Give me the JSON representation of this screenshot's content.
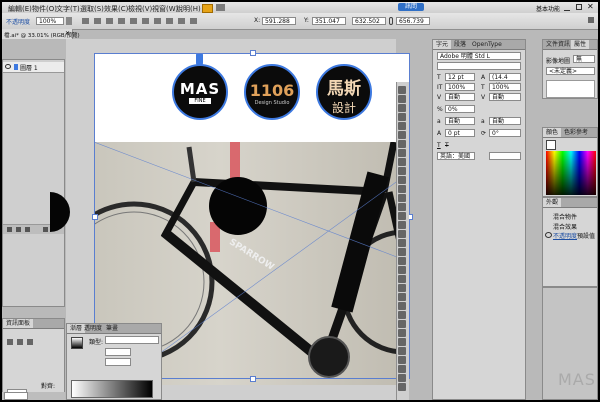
{
  "menubar": {
    "items": [
      "編輯(E)",
      "物件(O)",
      "文字(T)",
      "選取(S)",
      "效果(C)",
      "檢視(V)",
      "視窗(W)",
      "說明(H)"
    ],
    "workspace_label": "基本功能",
    "search_badge": "訊問"
  },
  "controlbar": {
    "selection_label": "不透明度",
    "opacity_value": "100%",
    "x_label": "X:",
    "x_value": "591.288",
    "y_label": "Y:",
    "y_value": "351.047",
    "w_label": "W:",
    "w_value": "632.502",
    "h_label": "H:",
    "h_value": "656.739"
  },
  "document": {
    "tab_title": "檔.ai* @ 33.01% (RGB/預覽)",
    "logos": [
      {
        "text": "MAS",
        "sub": "FINE"
      },
      {
        "text": "1106",
        "sub": "Design Studio"
      },
      {
        "text": "馬斯",
        "sub": "設計"
      }
    ],
    "bike_text": "SPARROW"
  },
  "layers_panel": {
    "layer_name": "圖層 1"
  },
  "character_panel": {
    "tabs": [
      "字元",
      "段落",
      "OpenType"
    ],
    "font_family": "Adobe 明體 Std L",
    "font_style": "",
    "size": "12 pt",
    "leading": "(14.4 pt)",
    "vscale": "100%",
    "hscale": "100%",
    "kerning": "自動",
    "tracking": "自動",
    "tsume": "0%",
    "baseline": "0 pt",
    "rotate": "0°",
    "language": "英語：美國",
    "auto1": "自動",
    "auto2": "自動"
  },
  "right_panel": {
    "tabs": [
      "文件資訊",
      "屬性"
    ],
    "image_map_label": "影像地圖",
    "image_map_value": "無",
    "url_value": "<未定義>",
    "color_tabs": [
      "顏色",
      "色彩參考"
    ],
    "appearance_title": "外觀",
    "appearance_row1": "混合物件",
    "appearance_row2": "混合效果",
    "appearance_row3": "不透明度",
    "appearance_row3_value": "預設值"
  },
  "gradient_panel": {
    "tabs": [
      "漸層",
      "透明度",
      "筆畫"
    ],
    "type_label": "類型:",
    "opacity_label": "不透明度:",
    "location_label": "對齊:"
  },
  "bottom_left_panel": {
    "title": "資訊面板"
  },
  "watermark": "MAS"
}
